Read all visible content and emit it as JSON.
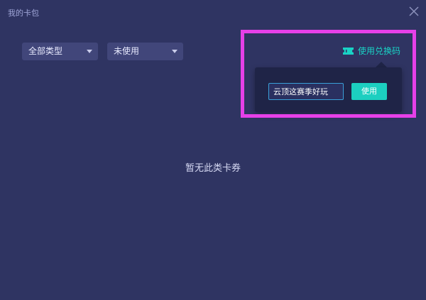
{
  "window": {
    "title": "我的卡包"
  },
  "filters": {
    "type_select": {
      "value": "全部类型"
    },
    "status_select": {
      "value": "未使用"
    }
  },
  "redeem": {
    "link_label": "使用兑换码",
    "input_value": "云顶这赛季好玩",
    "use_button_label": "使用"
  },
  "empty_state": {
    "message": "暂无此类卡券"
  },
  "colors": {
    "background": "#2f3462",
    "accent": "#1ccfc0",
    "popover": "#1f2447",
    "highlight": "#e640e8"
  },
  "icons": {
    "close": "close-icon",
    "ticket": "ticket-icon",
    "caret": "chevron-down-icon"
  }
}
